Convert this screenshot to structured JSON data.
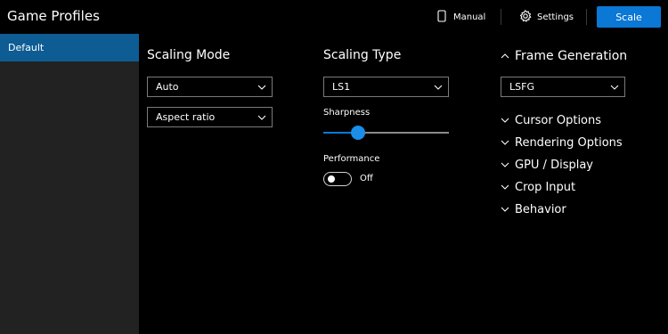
{
  "header": {
    "title": "Game Profiles",
    "manual_label": "Manual",
    "settings_label": "Settings",
    "scale_label": "Scale",
    "accent_color": "#0a78d4"
  },
  "sidebar": {
    "profiles": [
      {
        "label": "Default",
        "selected": true
      }
    ]
  },
  "scaling_mode": {
    "title": "Scaling Mode",
    "mode_value": "Auto",
    "aspect_value": "Aspect ratio"
  },
  "scaling_type": {
    "title": "Scaling Type",
    "type_value": "LS1",
    "sharpness_label": "Sharpness",
    "sharpness_level": 0.28,
    "performance_label": "Performance",
    "performance_state": "Off"
  },
  "frame_generation": {
    "title": "Frame Generation",
    "value": "LSFG",
    "expanded": true
  },
  "sections": [
    {
      "label": "Cursor Options"
    },
    {
      "label": "Rendering Options"
    },
    {
      "label": "GPU / Display"
    },
    {
      "label": "Crop Input"
    },
    {
      "label": "Behavior"
    }
  ],
  "icons": {
    "manual": "document-icon",
    "settings": "gear-icon",
    "dropdown": "chevron-down-icon",
    "collapse": "chevron-up-icon",
    "expand": "chevron-down-icon"
  }
}
